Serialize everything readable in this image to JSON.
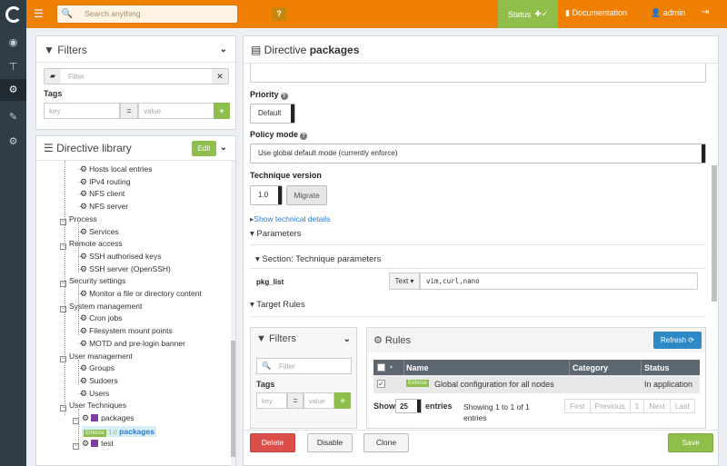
{
  "topbar": {
    "search_placeholder": "Search anything",
    "help": "?",
    "status": "Status",
    "documentation": "Documentation",
    "user": "admin"
  },
  "icons": {
    "logo": "rudder-logo",
    "menu": "hamburger-icon",
    "search": "search-icon",
    "status": "puzzle-check-icon",
    "doc": "book-icon",
    "user": "user-icon",
    "logout": "logout-icon",
    "sidebar": [
      "dashboard-icon",
      "nodes-icon",
      "config-icon",
      "admin-icon",
      "settings-icon"
    ]
  },
  "filters": {
    "title": "Filters",
    "filter_placeholder": "Filter",
    "tags": "Tags",
    "key_placeholder": "key",
    "eq": "=",
    "value_placeholder": "value",
    "add": "+"
  },
  "library": {
    "title": "Directive library",
    "edit": "Edit",
    "items": [
      {
        "t": "Hosts local entries",
        "kind": "leaf"
      },
      {
        "t": "IPv4 routing",
        "kind": "leaf"
      },
      {
        "t": "NFS client",
        "kind": "leaf"
      },
      {
        "t": "NFS server",
        "kind": "leaf"
      },
      {
        "t": "Process",
        "kind": "cat"
      },
      {
        "t": "Services",
        "kind": "leaf"
      },
      {
        "t": "Remote access",
        "kind": "cat"
      },
      {
        "t": "SSH authorised keys",
        "kind": "leaf"
      },
      {
        "t": "SSH server (OpenSSH)",
        "kind": "leaf"
      },
      {
        "t": "Security settings",
        "kind": "cat"
      },
      {
        "t": "Monitor a file or directory content",
        "kind": "leaf"
      },
      {
        "t": "System management",
        "kind": "cat"
      },
      {
        "t": "Cron jobs",
        "kind": "leaf"
      },
      {
        "t": "Filesystem mount points",
        "kind": "leaf"
      },
      {
        "t": "MOTD and pre-login banner",
        "kind": "leaf"
      },
      {
        "t": "User management",
        "kind": "cat"
      },
      {
        "t": "Groups",
        "kind": "leaf"
      },
      {
        "t": "Sudoers",
        "kind": "leaf"
      },
      {
        "t": "Users",
        "kind": "leaf"
      },
      {
        "t": "User Techniques",
        "kind": "cat"
      },
      {
        "t": "packages",
        "kind": "tech"
      },
      {
        "t": "packages",
        "kind": "directive",
        "badge": "Enforce",
        "version": "1.0"
      },
      {
        "t": "test",
        "kind": "tech"
      }
    ]
  },
  "directive": {
    "title_prefix": "Directive",
    "title_name": "packages",
    "priority_label": "Priority",
    "priority_value": "Default",
    "policy_label": "Policy mode",
    "policy_value": "Use global default mode (currently enforce)",
    "tv_label": "Technique version",
    "tv_value": "1.0",
    "migrate": "Migrate",
    "show_details": "Show technical details",
    "parameters": "Parameters",
    "section": "Section: Technique parameters",
    "param_name": "pkg_list",
    "param_type": "Text",
    "param_value": "vim,curl,nano",
    "target_rules": "Target Rules"
  },
  "rules_filters": {
    "title": "Filters",
    "filter_placeholder": "Filter",
    "tags": "Tags",
    "key_placeholder": "key",
    "eq": "=",
    "value_placeholder": "value",
    "add": "+"
  },
  "rules": {
    "title": "Rules",
    "refresh": "Refresh",
    "columns": [
      "Name",
      "Category",
      "Status"
    ],
    "rows": [
      {
        "badge": "Enforce",
        "name": "Global configuration for all nodes",
        "category": "",
        "status": "In application"
      }
    ],
    "show": "Show",
    "page_size": "25",
    "entries": "entries",
    "info": "Showing 1 to 1 of 1 entries",
    "pager": [
      "First",
      "Previous",
      "1",
      "Next",
      "Last"
    ]
  },
  "actions": {
    "delete": "Delete",
    "disable": "Disable",
    "clone": "Clone",
    "save": "Save"
  },
  "colors": {
    "accent": "#f08004",
    "sidebar": "#2f3d47",
    "success": "#8fbf4a",
    "danger": "#da4f49",
    "primary": "#2d8ac7"
  }
}
